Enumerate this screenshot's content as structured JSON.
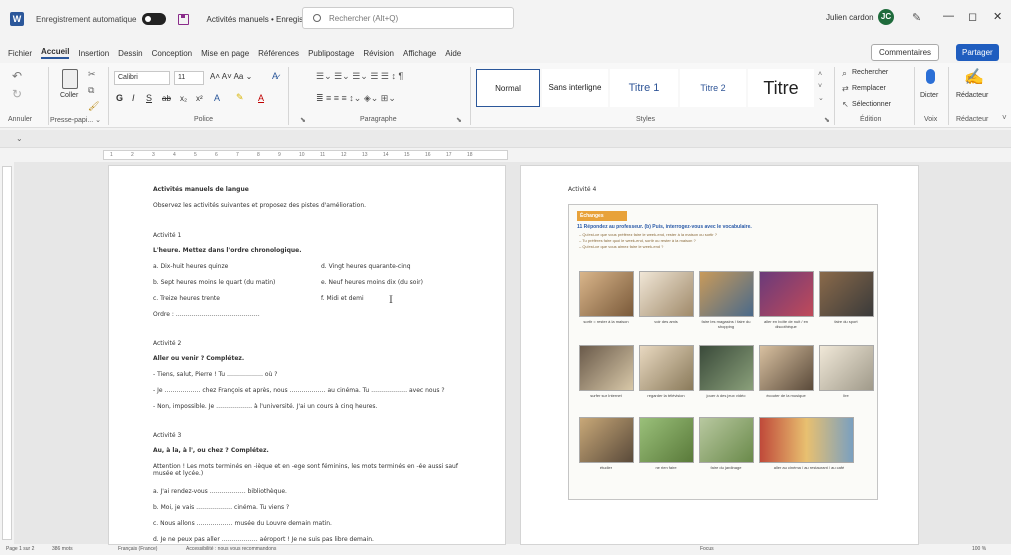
{
  "titlebar": {
    "autosave_label": "Enregistrement automatique",
    "doc_title": "Activités manuels • Enregistré dans ce PC ⌄",
    "search_placeholder": "Rechercher (Alt+Q)",
    "user_name": "Julien cardon",
    "avatar_initial": "JC",
    "minimize": "—",
    "restore": "◻",
    "close": "✕"
  },
  "menu": {
    "items": [
      "Fichier",
      "Accueil",
      "Insertion",
      "Dessin",
      "Conception",
      "Mise en page",
      "Références",
      "Publipostage",
      "Révision",
      "Affichage",
      "Aide"
    ],
    "active": "Accueil",
    "comments_label": "Commentaires",
    "share_label": "Partager"
  },
  "ribbon": {
    "group_labels": {
      "undo": "Annuler",
      "clipboard": "Presse-papi... ⌄",
      "font": "Police",
      "paragraph": "Paragraphe",
      "styles": "Styles",
      "editing": "Édition",
      "voice": "Voix",
      "editor": "Rédacteur"
    },
    "paste_label": "Coller",
    "font_name": "Calibri",
    "font_size": "11",
    "styles": [
      "Normal",
      "Sans interligne",
      "Titre 1",
      "Titre 2",
      "Titre"
    ],
    "editing": {
      "find": "Rechercher",
      "replace": "Remplacer",
      "select": "Sélectionner"
    },
    "dictate_label": "Dicter",
    "editor_label": "Rédacteur"
  },
  "ruler_marks": [
    "1",
    "2",
    "3",
    "4",
    "5",
    "6",
    "7",
    "8",
    "9",
    "10",
    "11",
    "12",
    "13",
    "14",
    "15",
    "16",
    "17",
    "18"
  ],
  "page1": {
    "title": "Activités manuels de langue",
    "intro": "Observez les activités suivantes et proposez des pistes d'amélioration.",
    "a1_heading": "Activité 1",
    "a1_instruction": "L'heure. Mettez dans l'ordre chronologique.",
    "a1_items": [
      "a. Dix-huit heures quinze",
      "b. Sept heures moins le quart (du matin)",
      "c. Treize heures trente",
      "d. Vingt heures quarante-cinq",
      "e. Neuf heures moins dix (du soir)",
      "f. Midi et demi"
    ],
    "a1_order": "Ordre : ……………………………………",
    "a2_heading": "Activité 2",
    "a2_instruction": "Aller ou venir ? Complétez.",
    "a2_lines": [
      "- Tiens, salut, Pierre ! Tu ……………… où ?",
      "- Je ……………… chez François et après, nous ……………… au cinéma. Tu ……………… avec nous ?",
      "- Non, impossible. Je ……………… à l'université. J'ai un cours à cinq heures."
    ],
    "a3_heading": "Activité 3",
    "a3_instruction": "Au, à la, à l', ou chez ? Complétez.",
    "a3_note": "Attention ! Les mots terminés en -ièque et en -ege sont féminins, les mots terminés en -ée aussi sauf musée et lycée.)",
    "a3_lines": [
      "a. J'ai rendez-vous ……………… bibliothèque.",
      "b. Moi, je vais ……………… cinéma. Tu viens ?",
      "c. Nous allons ……………… musée du Louvre demain matin.",
      "d. Je ne peux pas aller ……………… aéroport ! Je ne suis pas libre demain."
    ]
  },
  "page2": {
    "heading": "Activité 4",
    "band": "Échanges",
    "question": "11 Répondez au professeur. (b) Puis, interrogez-vous avec le vocabulaire.",
    "sub_lines": [
      "– Qu'est-ce que vous préférez faire le week-end, rester à la maison ou sortir ?",
      "– Tu préfères faire quoi le week-end, sortir ou rester à la maison ?",
      "– Qu'est-ce que vous aimez faire le week-end ?"
    ],
    "captions": [
      "sortir = rester à la maison",
      "voir des amis",
      "faire les magasins / faire du shopping",
      "aller en boîte de nuit / en discothèque",
      "faire du sport",
      "surfer sur Internet",
      "regarder la télévision",
      "jouer à des jeux vidéo",
      "écouter de la musique",
      "lire",
      "étudier",
      "ne rien faire",
      "faire du jardinage",
      "aller au cinéma / au restaurant / au café"
    ]
  },
  "statusbar": {
    "page": "Page 1 sur 2",
    "words": "386 mots",
    "language": "Français (France)",
    "accessibility": "Accessibilité : nous vous recommandons",
    "focus": "Focus",
    "zoom": "100 %"
  }
}
